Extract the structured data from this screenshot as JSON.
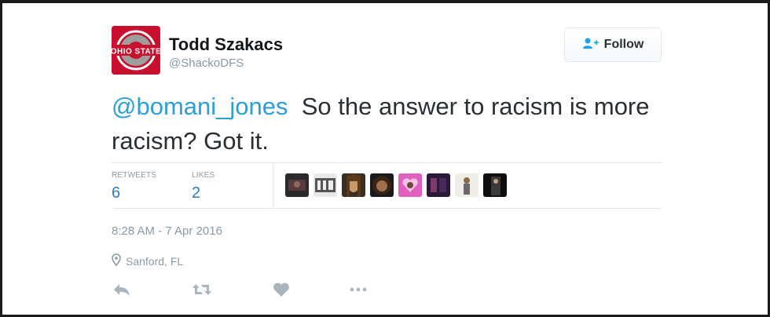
{
  "user": {
    "name": "Todd Szakacs",
    "handle": "@ShackoDFS",
    "avatar_text": "OHIO STATE"
  },
  "follow_button": {
    "label": "Follow"
  },
  "tweet": {
    "mention": "@bomani_jones",
    "text": "So the answer to racism is more racism?  Got it."
  },
  "stats": {
    "retweets_label": "RETWEETS",
    "retweets_count": "6",
    "likes_label": "LIKES",
    "likes_count": "2"
  },
  "timestamp": "8:28 AM - 7 Apr 2016",
  "location": "Sanford, FL",
  "actions": [
    "reply",
    "retweet",
    "like",
    "more"
  ],
  "colors": {
    "link": "#2b9fd8",
    "count": "#2b7bb9",
    "muted": "#8899a6",
    "avatar_red": "#c8102e"
  }
}
